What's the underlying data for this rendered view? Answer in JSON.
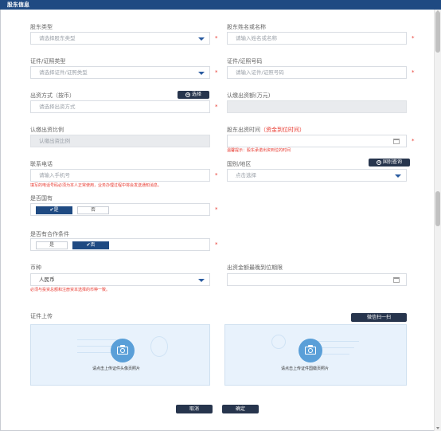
{
  "panel": {
    "title": "股东信息"
  },
  "row1": {
    "shareholder_type": {
      "label": "股东类型",
      "placeholder": "请选择股东类型"
    },
    "shareholder_name": {
      "label": "股东姓名或名称",
      "placeholder": "请输入姓名或名称"
    }
  },
  "row2": {
    "id_type": {
      "label": "证件/证照类型",
      "placeholder": "请选择证件/证照类型"
    },
    "id_number": {
      "label": "证件/证照号码",
      "placeholder": "请输入证件/证照号码"
    }
  },
  "row3": {
    "contribution_method": {
      "label": "出资方式（按币）",
      "placeholder": "请选择出资方式",
      "select_button": "选择"
    },
    "subscribed_amount": {
      "label": "认缴出资额(万元)"
    }
  },
  "row4": {
    "subscribed_ratio": {
      "label": "认缴出资比例",
      "placeholder": "认缴出资比例"
    },
    "contribution_time": {
      "label": "股东出资时间",
      "label_red": "（资金到位时间）",
      "hint": "温馨提示：股东承诺出资到位的时间"
    }
  },
  "row5": {
    "phone": {
      "label": "联系电话",
      "placeholder": "请输入手机号",
      "hint": "填写的电话号码必须为本人正常使用，业务办理过程中将会发送通知消息。"
    },
    "region": {
      "label": "国别/地区",
      "placeholder": "点击选择",
      "query_button": "国别查询"
    }
  },
  "row6": {
    "state_owned": {
      "label": "是否国有",
      "yes": "✔是",
      "no": "否"
    }
  },
  "row7": {
    "cooperation": {
      "label": "是否有合作条件",
      "yes": "是",
      "no": "✔否"
    }
  },
  "row8": {
    "currency": {
      "label": "币种",
      "value": "人民币",
      "hint": "必须与投资总额和注册资本选择的币种一致。"
    },
    "full_payment_deadline": {
      "label": "出资金额最晚到位期限"
    }
  },
  "upload": {
    "label": "证件上传",
    "wechat_button": "微信扫一扫",
    "front_caption": "请点击上传证件头像页照片",
    "back_caption": "请点击上传证件国徽页照片"
  },
  "footer": {
    "cancel": "取消",
    "confirm": "确定"
  },
  "colors": {
    "titlebar": "#1f4a82",
    "accent": "#2a5ba0",
    "required": "#e8382e",
    "button": "#27354d",
    "upload_bg": "#e8f2fc"
  }
}
